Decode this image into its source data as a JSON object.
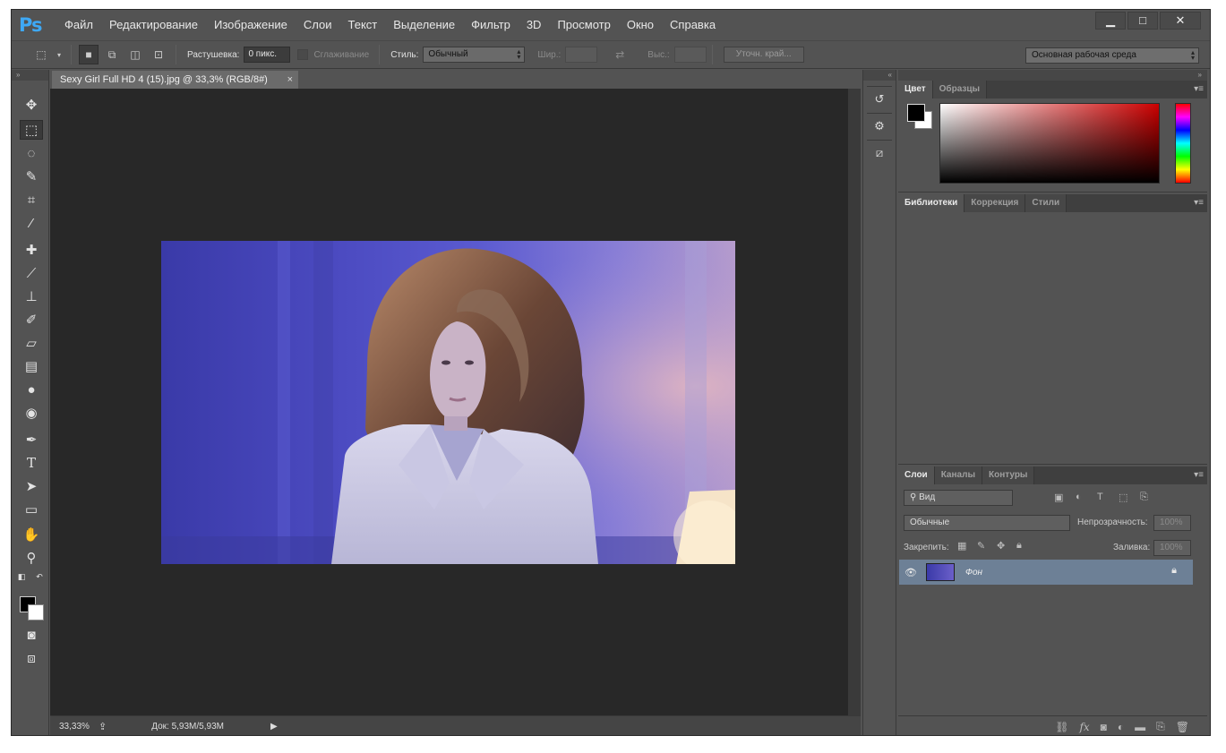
{
  "app": {
    "logo": "Ps"
  },
  "menu": [
    "Файл",
    "Редактирование",
    "Изображение",
    "Слои",
    "Текст",
    "Выделение",
    "Фильтр",
    "3D",
    "Просмотр",
    "Окно",
    "Справка"
  ],
  "window_controls": {
    "minimize": "▁",
    "maximize": "□",
    "close": "✕"
  },
  "options": {
    "feather_label": "Растушевка:",
    "feather_value": "0 пикс.",
    "antialias_label": "Сглаживание",
    "style_label": "Стиль:",
    "style_value": "Обычный",
    "width_label": "Шир.:",
    "height_label": "Выс.:",
    "refine_edge_button": "Уточн. край...",
    "workspace": "Основная рабочая среда"
  },
  "document": {
    "tab_title": "Sexy Girl Full HD 4 (15).jpg @ 33,3% (RGB/8#)",
    "close_glyph": "×"
  },
  "status": {
    "zoom": "33,33%",
    "doc_size": "Док: 5,93M/5,93M"
  },
  "panels": {
    "color_tabs": [
      "Цвет",
      "Образцы"
    ],
    "library_tabs": [
      "Библиотеки",
      "Коррекция",
      "Стили"
    ],
    "layers_tabs": [
      "Слои",
      "Каналы",
      "Контуры"
    ],
    "layers": {
      "filter_label": "Вид",
      "blend_mode": "Обычные",
      "opacity_label": "Непрозрачность:",
      "opacity_value": "100%",
      "lock_label": "Закрепить:",
      "fill_label": "Заливка:",
      "fill_value": "100%",
      "items": [
        {
          "name": "Фон",
          "visible": true,
          "locked": true
        }
      ]
    }
  },
  "colors": {
    "foreground": "#000000",
    "background": "#ffffff",
    "accent": "#3ea8f5",
    "selected_layer": "#6d8096"
  },
  "icons": {
    "tools": [
      "move-icon",
      "marquee-icon",
      "lasso-icon",
      "quick-select-icon",
      "crop-icon",
      "eyedropper-icon",
      "healing-brush-icon",
      "brush-icon",
      "clone-stamp-icon",
      "history-brush-icon",
      "eraser-icon",
      "gradient-icon",
      "blur-icon",
      "dodge-icon",
      "pen-icon",
      "type-icon",
      "path-select-icon",
      "rectangle-icon",
      "hand-icon",
      "zoom-icon"
    ]
  }
}
